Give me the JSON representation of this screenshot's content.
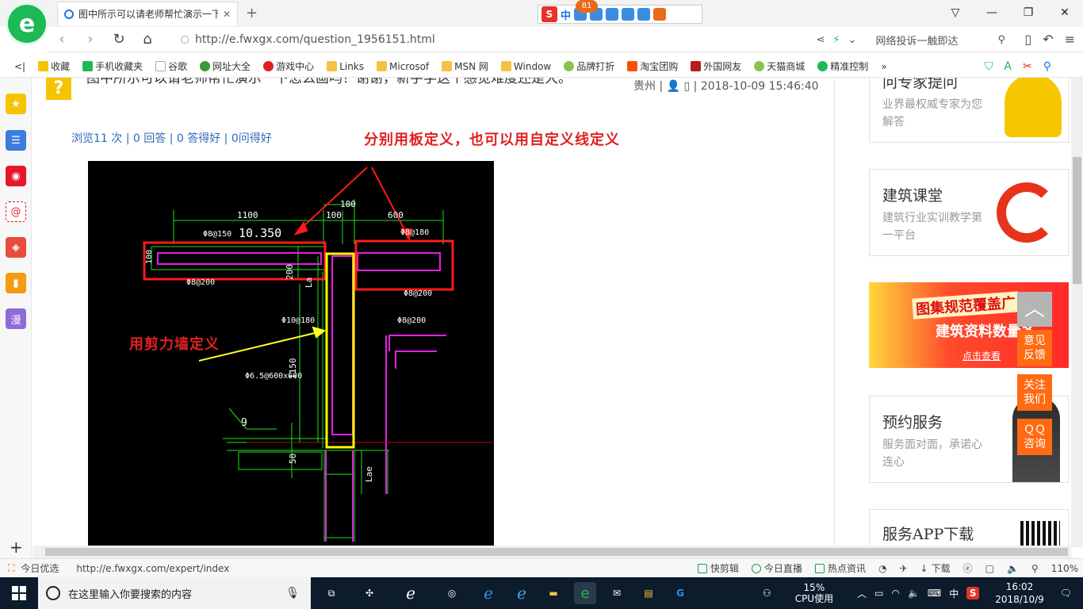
{
  "browser": {
    "tab_title": "图中所示可以请老师帮忙演示一下",
    "tab_close": "✕",
    "new_tab": "+",
    "ime_label": "中",
    "ime_badge": "81",
    "url": "http://e.fwxgx.com/question_1956151.html",
    "search_hint": "网络投诉一触即达",
    "window_controls": [
      "▽",
      "—",
      "❐",
      "✕"
    ]
  },
  "bookmarks": {
    "collapse": "<|",
    "items": [
      "收藏",
      "手机收藏夹",
      "谷歌",
      "网址大全",
      "游戏中心",
      "Links",
      "Microsof",
      "MSN 网",
      "Window",
      "品牌打折",
      "淘宝团购",
      "外国网友",
      "天猫商城",
      "精准控制"
    ],
    "more": "»"
  },
  "side_panel": {
    "icons": [
      "favorites-icon",
      "apps-icon",
      "weibo-icon",
      "mail-icon",
      "game-icon",
      "book-icon",
      "comic-icon"
    ],
    "comic_label": "漫",
    "add": "+"
  },
  "question": {
    "title": "图中所示可以请老师帮忙演示一下怎么画吗？谢谢，新手学这个感觉难度还是大。",
    "meta": "贵州 | 👤 ▯ | 2018-10-09 15:46:40",
    "stats": "浏览11 次 | 0 回答 | 0 答得好 | 0问得好",
    "annotation_top": "分别用板定义，也可以用自定义线定义",
    "annotation_left": "用剪力墙定义"
  },
  "cad": {
    "dims": [
      "1100",
      "100",
      "100",
      "600"
    ],
    "elevation": "10.350",
    "rebar_labels": [
      "Φ8@150",
      "Φ8@180",
      "Φ8@200",
      "Φ8@200",
      "Φ10@180",
      "Φ8@200",
      "Φ6.5@600x600"
    ],
    "vertical_dims": [
      "200",
      "1150",
      "50",
      "Lae",
      "La"
    ],
    "slab_thk": "100",
    "marker": "9"
  },
  "aside": {
    "card1": {
      "title": "问专家提问",
      "desc": "业界最权威专家为您解答"
    },
    "card2": {
      "title": "建筑课堂",
      "desc": "建筑行业实训教学第一平台"
    },
    "banner": {
      "line1": "图集规范覆盖广",
      "line2": "建筑资料数量多",
      "cta": "点击查看"
    },
    "card3": {
      "title": "预约服务",
      "desc": "服务面对面，承诺心连心"
    },
    "card4": {
      "title": "服务APP下载"
    }
  },
  "float_buttons": {
    "top": "︿",
    "feedback": "意见反馈",
    "follow": "关注我们",
    "qq": "ＱＱ咨询"
  },
  "statusbar": {
    "today": "今日优选",
    "hover_url": "http://e.fwxgx.com/expert/index",
    "items": [
      "快剪辑",
      "今日直播",
      "热点资讯",
      "下载"
    ],
    "zoom": "110%"
  },
  "taskbar": {
    "search_placeholder": "在这里输入你要搜索的内容",
    "cpu_pct": "15%",
    "cpu_label": "CPU使用",
    "ime": "中",
    "time": "16:02",
    "date": "2018/10/9"
  }
}
